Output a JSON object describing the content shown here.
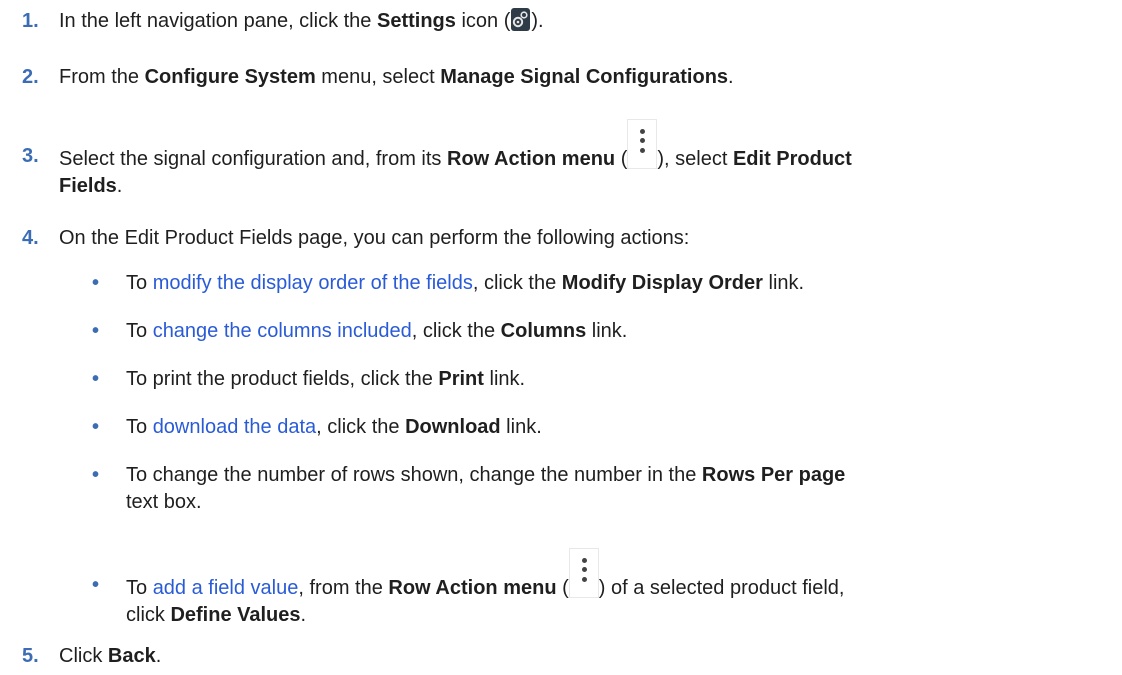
{
  "steps": [
    {
      "num": "1.",
      "pre": "In the left navigation pane, click the ",
      "b1": "Settings",
      "post": " icon (",
      "icon": "settings-gear-icon",
      "end": ")."
    },
    {
      "num": "2.",
      "pre": "From the ",
      "b1": "Configure System",
      "mid": " menu, select ",
      "b2": "Manage Signal Configurations",
      "end": "."
    },
    {
      "num": "3.",
      "pre": "Select the signal configuration and, from its ",
      "b1": "Row Action menu",
      "mid1": " (",
      "icon": "row-action-kebab-icon",
      "mid2": "), select ",
      "b2": "Edit Product",
      "b3": "Fields",
      "end": "."
    },
    {
      "num": "4.",
      "text": "On the Edit Product Fields page, you can perform the following actions:"
    },
    {
      "num": "5.",
      "pre": "Click ",
      "b1": "Back",
      "end": "."
    }
  ],
  "bullets": [
    {
      "dot": "•",
      "pre": "To ",
      "link": "modify the display order of the fields",
      "mid": ", click the ",
      "b": "Modify Display Order",
      "end": " link."
    },
    {
      "dot": "•",
      "pre": "To ",
      "link": "change the columns included",
      "mid": ", click the ",
      "b": "Columns",
      "end": " link."
    },
    {
      "dot": "•",
      "pre": "To print the product fields, click the ",
      "b": "Print",
      "end": " link."
    },
    {
      "dot": "•",
      "pre": "To ",
      "link": "download the data",
      "mid": ", click the ",
      "b": "Download",
      "end": " link."
    },
    {
      "dot": "•",
      "pre": "To change the number of rows shown, change the number in the ",
      "b": "Rows Per page",
      "line2": "text box."
    },
    {
      "dot": "•",
      "pre": "To ",
      "link": "add a field value",
      "mid": ", from the ",
      "b": "Row Action menu",
      "mid2": " (",
      "icon": "row-action-kebab-icon",
      "mid3": ") of a selected product field,",
      "line2pre": "click ",
      "b2": "Define Values",
      "end": "."
    }
  ],
  "colors": {
    "accent": "#3c6cb4",
    "link": "#2a5bd7",
    "text": "#1f1f1f"
  }
}
